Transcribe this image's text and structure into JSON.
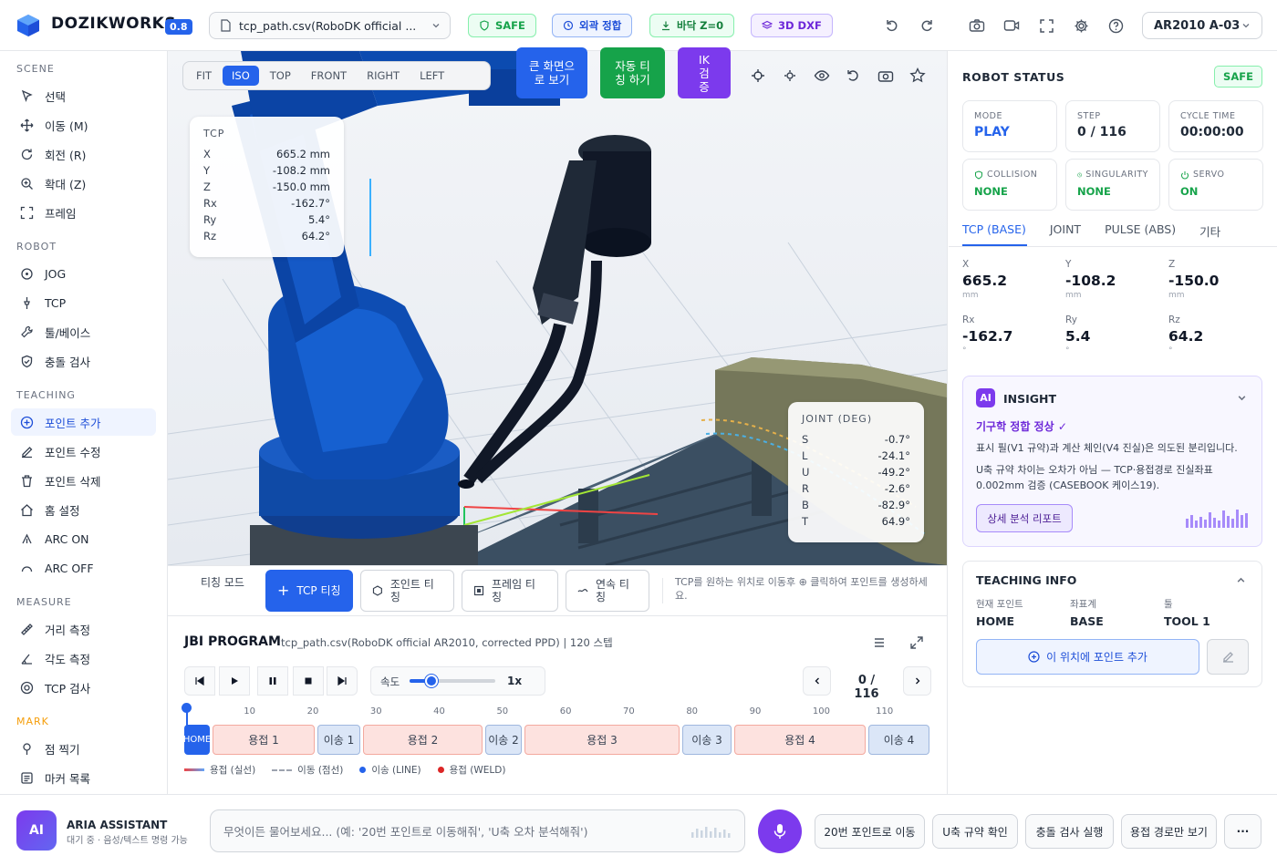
{
  "app": {
    "brand": "DOZIKWORKS",
    "version": "0.8",
    "file": "tcp_path.csv(RoboDK official ...",
    "robot": "AR2010 A-03"
  },
  "chips": [
    {
      "label": "SAFE"
    },
    {
      "label": "외곽 정합"
    },
    {
      "label": "바닥 Z=0"
    },
    {
      "label": "3D DXF"
    }
  ],
  "colors": {
    "accent": "#2563eb",
    "safe": "#16a34a",
    "purple": "#7c3aed",
    "weld_segment": "#fde2df",
    "move_segment": "#dbe6f7"
  },
  "sidebar": {
    "sections": [
      {
        "title": "SCENE",
        "items": [
          {
            "label": "선택",
            "icon": "cursor-icon"
          },
          {
            "label": "이동 (M)",
            "icon": "move-icon"
          },
          {
            "label": "회전 (R)",
            "icon": "rotate-icon"
          },
          {
            "label": "확대 (Z)",
            "icon": "zoom-icon"
          },
          {
            "label": "프레임",
            "icon": "frame-icon"
          }
        ]
      },
      {
        "title": "ROBOT",
        "items": [
          {
            "label": "JOG",
            "icon": "jog-icon"
          },
          {
            "label": "TCP",
            "icon": "tcp-icon"
          },
          {
            "label": "툴/베이스",
            "icon": "wrench-icon"
          },
          {
            "label": "충돌 검사",
            "icon": "shield-icon"
          }
        ]
      },
      {
        "title": "TEACHING",
        "items": [
          {
            "label": "포인트 추가",
            "icon": "plus-circle-icon"
          },
          {
            "label": "포인트 수정",
            "icon": "edit-icon"
          },
          {
            "label": "포인트 삭제",
            "icon": "trash-icon"
          },
          {
            "label": "홈 설정",
            "icon": "home-icon"
          },
          {
            "label": "ARC ON",
            "icon": "arc-on-icon"
          },
          {
            "label": "ARC OFF",
            "icon": "arc-off-icon"
          }
        ]
      },
      {
        "title": "MEASURE",
        "items": [
          {
            "label": "거리 측정",
            "icon": "ruler-icon"
          },
          {
            "label": "각도 측정",
            "icon": "angle-icon"
          },
          {
            "label": "TCP 검사",
            "icon": "target-icon"
          }
        ]
      },
      {
        "title": "MARK",
        "items": [
          {
            "label": "점 찍기",
            "icon": "pin-icon"
          },
          {
            "label": "마커 목록",
            "icon": "list-icon"
          }
        ]
      }
    ]
  },
  "viewport": {
    "views": [
      "FIT",
      "ISO",
      "TOP",
      "FRONT",
      "RIGHT",
      "LEFT"
    ],
    "active_view": "ISO",
    "big_buttons": [
      "큰 화면으로 보기",
      "자동 티칭 하기",
      "IK 검증"
    ],
    "tcp_panel": {
      "title": "TCP",
      "rows": [
        [
          "X",
          "665.2 mm"
        ],
        [
          "Y",
          "-108.2 mm"
        ],
        [
          "Z",
          "-150.0 mm"
        ],
        [
          "Rx",
          "-162.7°"
        ],
        [
          "Ry",
          "5.4°"
        ],
        [
          "Rz",
          "64.2°"
        ]
      ]
    },
    "joint_panel": {
      "title": "JOINT (DEG)",
      "rows": [
        [
          "S",
          "-0.7°"
        ],
        [
          "L",
          "-24.1°"
        ],
        [
          "U",
          "-49.2°"
        ],
        [
          "R",
          "-2.6°"
        ],
        [
          "B",
          "-82.9°"
        ],
        [
          "T",
          "64.9°"
        ]
      ]
    }
  },
  "teaching": {
    "mode_label": "티칭 모드",
    "buttons": [
      "TCP 티칭",
      "조인트 티칭",
      "프레임 티칭",
      "연속 티칭"
    ],
    "hint": "TCP를 원하는 위치로 이동후 ⊕ 클릭하여 포인트를 생성하세요."
  },
  "jbi": {
    "title": "JBI PROGRAM",
    "subtitle": "tcp_path.csv(RoboDK official AR2010, corrected PPD) | 120 스텝",
    "speed_label": "속도",
    "speed_value": "1x",
    "speed_fraction": 0.25,
    "step": "0 / 116",
    "ticks": [
      "10",
      "20",
      "30",
      "40",
      "50",
      "60",
      "70",
      "80",
      "90",
      "100",
      "110"
    ],
    "segments": [
      {
        "label": "HOME",
        "type": "home"
      },
      {
        "label": "용접 1",
        "type": "weld"
      },
      {
        "label": "이송 1",
        "type": "move"
      },
      {
        "label": "용접 2",
        "type": "weld"
      },
      {
        "label": "이송 2",
        "type": "move"
      },
      {
        "label": "용접 3",
        "type": "weld"
      },
      {
        "label": "이송 3",
        "type": "move"
      },
      {
        "label": "용접 4",
        "type": "weld"
      },
      {
        "label": "이송 4",
        "type": "move"
      }
    ],
    "legend": [
      "용접 (실선)",
      "이동 (점선)",
      "이송 (LINE)",
      "용접 (WELD)"
    ]
  },
  "status": {
    "title": "ROBOT STATUS",
    "badge": "SAFE",
    "boxes": [
      {
        "label": "MODE",
        "value": "PLAY"
      },
      {
        "label": "STEP",
        "value": "0 / 116"
      },
      {
        "label": "CYCLE TIME",
        "value": "00:00:00"
      },
      {
        "label": "COLLISION",
        "value": "NONE"
      },
      {
        "label": "SINGULARITY",
        "value": "NONE"
      },
      {
        "label": "SERVO",
        "value": "ON"
      }
    ],
    "tabs": [
      "TCP (BASE)",
      "JOINT",
      "PULSE (ABS)",
      "기타"
    ],
    "coords": [
      {
        "label": "X",
        "value": "665.2",
        "unit": "mm"
      },
      {
        "label": "Y",
        "value": "-108.2",
        "unit": "mm"
      },
      {
        "label": "Z",
        "value": "-150.0",
        "unit": "mm"
      },
      {
        "label": "Rx",
        "value": "-162.7",
        "unit": "°"
      },
      {
        "label": "Ry",
        "value": "5.4",
        "unit": "°"
      },
      {
        "label": "Rz",
        "value": "64.2",
        "unit": "°"
      }
    ]
  },
  "insight": {
    "badge": "AI",
    "title": "INSIGHT",
    "headline": "기구학 정합 정상 ✓",
    "body1": "표시 필(V1 규약)과 계산 체인(V4 진실)은 의도된 분리입니다.",
    "body2": "U축 규약 차이는 오차가 아님 — TCP·용접경로 진실좌표 0.002mm 검증 (CASEBOOK 케이스19).",
    "button": "상세 분석 리포트"
  },
  "teachinfo": {
    "title": "TEACHING INFO",
    "cols": [
      {
        "label": "현재 포인트",
        "value": "HOME"
      },
      {
        "label": "좌표계",
        "value": "BASE"
      },
      {
        "label": "툴",
        "value": "TOOL 1"
      }
    ],
    "add_button": "이 위치에 포인트 추가"
  },
  "assistant": {
    "avatar": "AI",
    "name": "ARIA ASSISTANT",
    "status": "대기 중 · 음성/텍스트 명령 가능",
    "placeholder": "무엇이든 물어보세요... (예: '20번 포인트로 이동해줘', 'U축 오차 분석해줘')",
    "quick": [
      "20번 포인트로 이동",
      "U축 규약 확인",
      "충돌 검사 실행",
      "용접 경로만 보기"
    ],
    "more": "···"
  }
}
